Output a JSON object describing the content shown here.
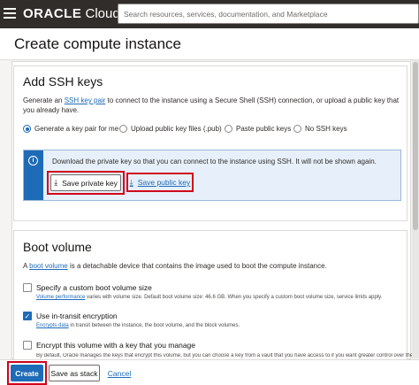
{
  "header": {
    "logo_brand": "ORACLE",
    "logo_product": " Cloud",
    "search_placeholder": "Search resources, services, documentation, and Marketplace"
  },
  "page": {
    "title": "Create compute instance"
  },
  "ssh": {
    "title": "Add SSH keys",
    "desc_prefix": "Generate an ",
    "desc_link": "SSH key pair",
    "desc_suffix": " to connect to the instance using a Secure Shell (SSH) connection, or upload a public key that you already have.",
    "options": [
      {
        "label": "Generate a key pair for me",
        "checked": true
      },
      {
        "label": "Upload public key files (.pub)",
        "checked": false
      },
      {
        "label": "Paste public keys",
        "checked": false
      },
      {
        "label": "No SSH keys",
        "checked": false
      }
    ],
    "info_text": "Download the private key so that you can connect to the instance using SSH. It will not be shown again.",
    "save_private_label": "Save private key",
    "save_public_label": "Save public key"
  },
  "boot": {
    "title": "Boot volume",
    "desc_prefix": "A ",
    "desc_link": "boot volume",
    "desc_suffix": " is a detachable device that contains the image used to boot the compute instance.",
    "custom_size_label": "Specify a custom boot volume size",
    "custom_size_help_link": "Volume performance",
    "custom_size_help": " varies with volume size. Default boot volume size: 46.6 GB. When you specify a custom boot volume size, service limits apply.",
    "encryption_label": "Use in-transit encryption",
    "encryption_help_link": "Encrypts data",
    "encryption_help": " in transit between the instance, the boot volume, and the block volumes.",
    "vault_label": "Encrypt this volume with a key that you manage",
    "vault_help": "By default, Oracle manages the keys that encrypt this volume, but you can choose a key from a vault that you have access to if you want greater control over the"
  },
  "footer": {
    "create_label": "Create",
    "save_stack_label": "Save as stack",
    "cancel_label": "Cancel"
  },
  "colors": {
    "accent": "#1e6bb8",
    "highlight": "#d0021b",
    "topbar": "#312d2a"
  }
}
